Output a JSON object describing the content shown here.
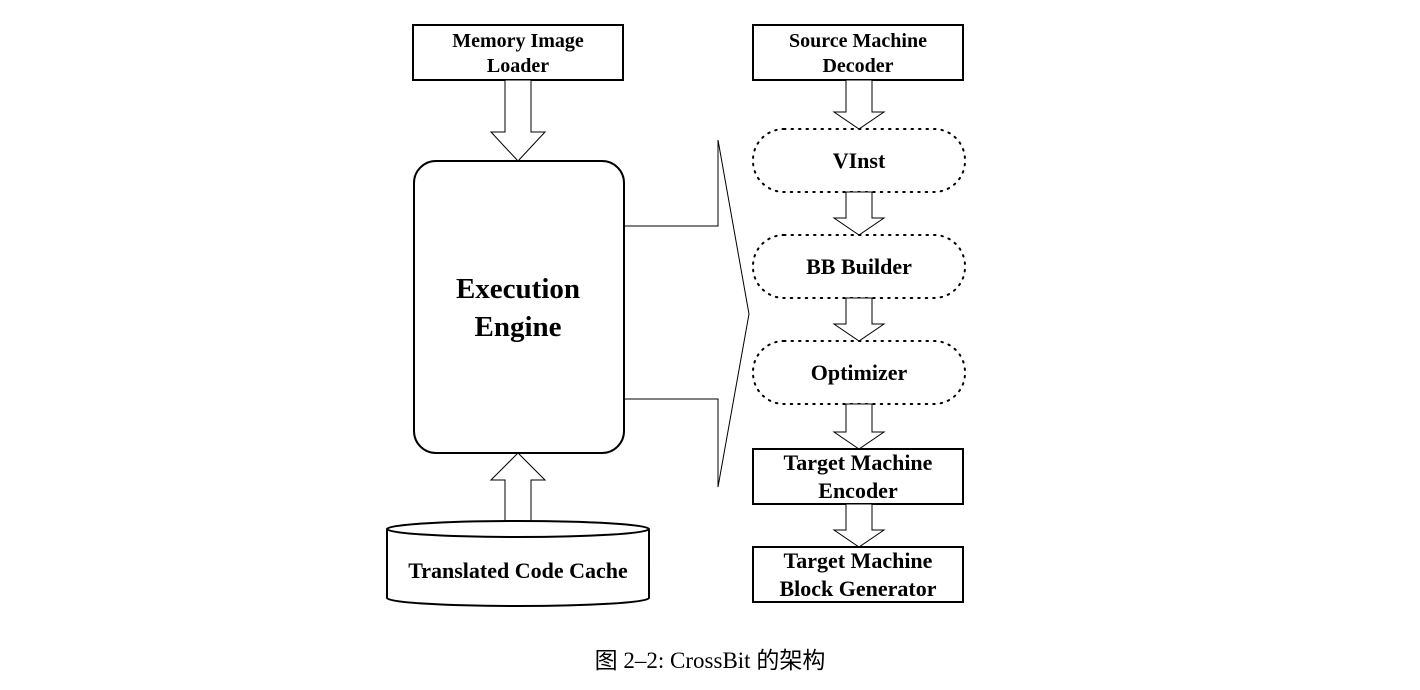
{
  "diagram": {
    "memory_loader": [
      "Memory Image",
      "Loader"
    ],
    "execution_engine": [
      "Execution",
      "Engine"
    ],
    "code_cache": "Translated Code Cache",
    "source_decoder": [
      "Source Machine",
      "Decoder"
    ],
    "vinst": "VInst",
    "bb_builder": "BB Builder",
    "optimizer": "Optimizer",
    "target_encoder": [
      "Target Machine",
      "Encoder"
    ],
    "block_generator": [
      "Target Machine",
      "Block Generator"
    ]
  },
  "caption": "图 2–2: CrossBit 的架构"
}
